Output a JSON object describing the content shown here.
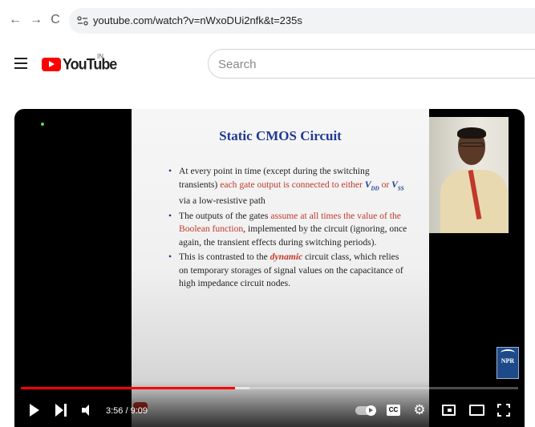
{
  "browser": {
    "url": "youtube.com/watch?v=nWxoDUi2nfk&t=235s"
  },
  "youtube": {
    "logo_text": "YouTube",
    "region": "IN",
    "search_placeholder": "Search"
  },
  "slide": {
    "title": "Static CMOS Circuit",
    "bullet1": {
      "text_a": "At every point in time (except during the switching transients) ",
      "text_red": "each gate output is connected to either ",
      "vdd": "V",
      "vdd_sub": "DD",
      "text_or": " or ",
      "vss": "V",
      "vss_sub": "SS",
      "text_b": " via a low-resistive path"
    },
    "bullet2": {
      "text_a": "The outputs of the gates ",
      "text_red": "assume at all times the value of the Boolean function",
      "text_b": ", implemented by the circuit (ignoring, once again, the transient effects during switching periods)."
    },
    "bullet3": {
      "text_a": "This is contrasted to the ",
      "text_em": "dynamic",
      "text_b": " circuit class, which relies on temporary storages of signal values on the capacitance of high impedance circuit nodes."
    },
    "logo_text": "NPR"
  },
  "player": {
    "time_display": "3:56 / 9:09",
    "progress_played_fraction": 0.43,
    "progress_loaded_fraction": 0.46,
    "cc_label": "CC"
  }
}
